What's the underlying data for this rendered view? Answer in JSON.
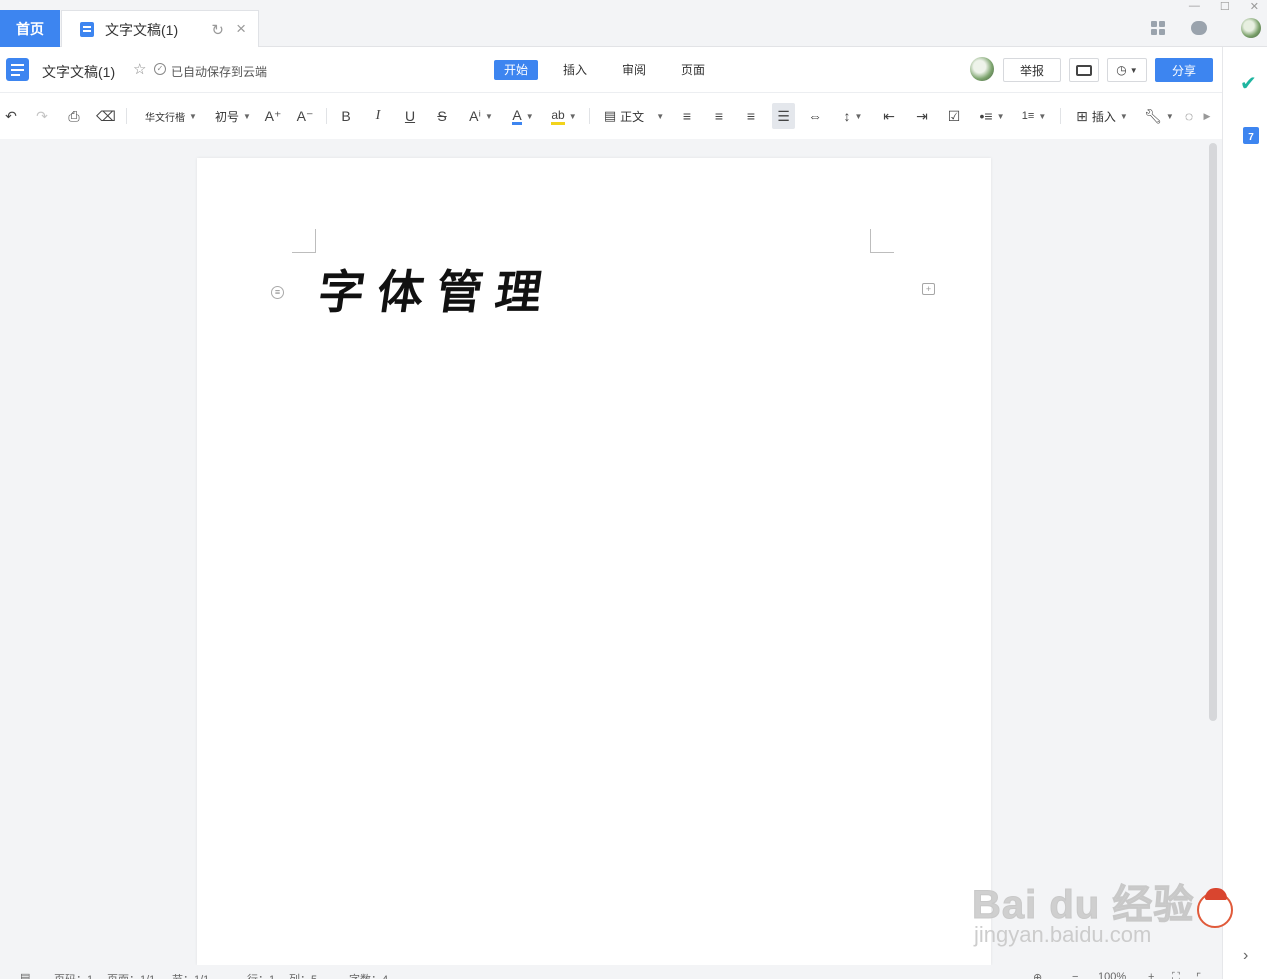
{
  "tabs": {
    "home_label": "首页",
    "doc_tab_title": "文字文稿(1)"
  },
  "docbar": {
    "doc_name": "文字文稿(1)",
    "save_status": "已自动保存到云端",
    "menu": [
      "开始",
      "插入",
      "审阅",
      "页面"
    ],
    "active_menu": "开始",
    "report_label": "举报",
    "share_label": "分享"
  },
  "toolbar": {
    "font_name": "华文行楷",
    "font_size": "初号",
    "style_name": "正文",
    "insert_label": "插入",
    "bold": "B",
    "italic": "I",
    "underline": "U",
    "strike": "S",
    "grow": "A⁺",
    "shrink": "A⁻",
    "text_color_glyph": "A",
    "highlight_glyph": "ab"
  },
  "document": {
    "heading": "字体管理"
  },
  "statusbar": {
    "page_num": "页码：1",
    "pages": "页面：1/1",
    "section": "节：1/1",
    "row": "行：1",
    "col": "列：5",
    "word_count": "字数：4",
    "zoom": "100%"
  },
  "watermark": {
    "brand": "Bai du 经验",
    "url": "jingyan.baidu.com"
  },
  "colors": {
    "accent": "#3d85f0",
    "rail_check": "#1fb5a0"
  }
}
